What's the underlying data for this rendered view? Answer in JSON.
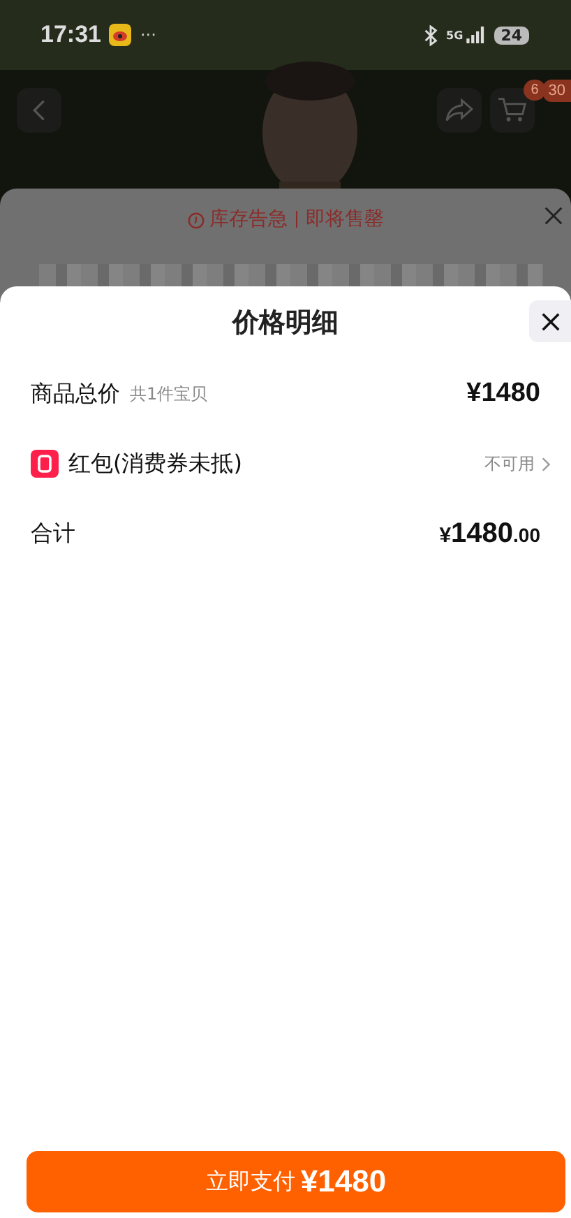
{
  "status_bar": {
    "time": "17:31",
    "more": "···",
    "network": "5G",
    "battery": "24"
  },
  "background_page": {
    "nav": {
      "cart_badge": "6",
      "badge_2": "30"
    },
    "stock_sheet": {
      "alert": "库存告急",
      "alert_2": "即将售罄"
    }
  },
  "price_sheet": {
    "title": "价格明细",
    "rows": [
      {
        "kind": "item",
        "label": "商品总价",
        "note": "共1件宝贝",
        "amount": "¥1480"
      },
      {
        "kind": "coupon",
        "label": "红包(消费券未抵)",
        "value": "不可用"
      },
      {
        "kind": "total",
        "label": "合计",
        "currency": "¥",
        "amount": "1480",
        "cents": ".00"
      }
    ],
    "pay_button": {
      "label": "立即支付",
      "amount": "¥1480"
    }
  }
}
